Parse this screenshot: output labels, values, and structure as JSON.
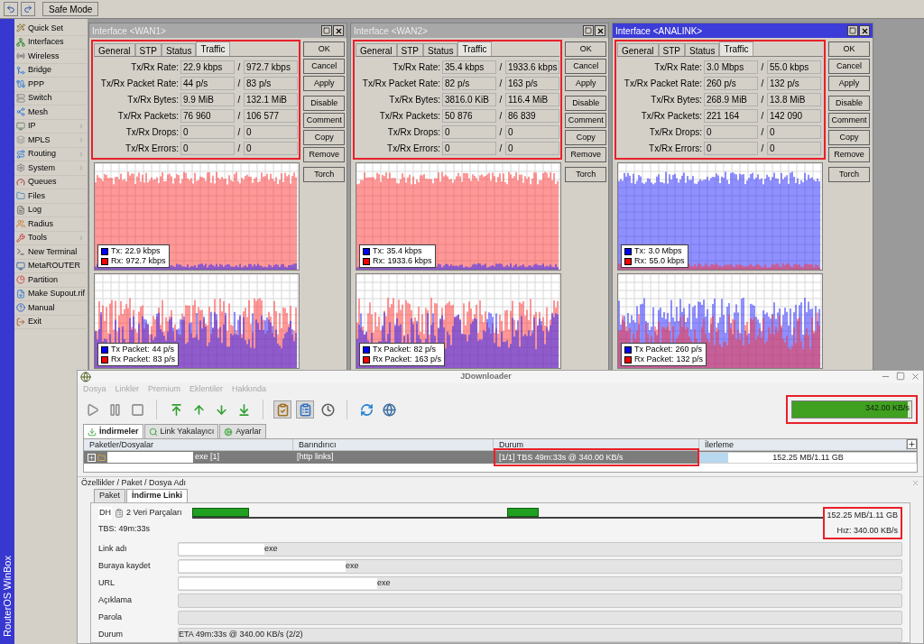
{
  "toolbar": {
    "safe_mode": "Safe Mode"
  },
  "brand": "RouterOS WinBox",
  "menu": [
    {
      "label": "Quick Set",
      "submenu": false
    },
    {
      "label": "Interfaces",
      "submenu": false
    },
    {
      "label": "Wireless",
      "submenu": false
    },
    {
      "label": "Bridge",
      "submenu": false
    },
    {
      "label": "PPP",
      "submenu": false
    },
    {
      "label": "Switch",
      "submenu": false
    },
    {
      "label": "Mesh",
      "submenu": false
    },
    {
      "label": "IP",
      "submenu": true
    },
    {
      "label": "MPLS",
      "submenu": true
    },
    {
      "label": "Routing",
      "submenu": true
    },
    {
      "label": "System",
      "submenu": true
    },
    {
      "label": "Queues",
      "submenu": false
    },
    {
      "label": "Files",
      "submenu": false
    },
    {
      "label": "Log",
      "submenu": false
    },
    {
      "label": "Radius",
      "submenu": false
    },
    {
      "label": "Tools",
      "submenu": true
    },
    {
      "label": "New Terminal",
      "submenu": false
    },
    {
      "label": "MetaROUTER",
      "submenu": false
    },
    {
      "label": "Partition",
      "submenu": false
    },
    {
      "label": "Make Supout.rif",
      "submenu": false
    },
    {
      "label": "Manual",
      "submenu": false
    },
    {
      "label": "Exit",
      "submenu": false
    }
  ],
  "windows": [
    {
      "title": "Interface <WAN1>",
      "active": false,
      "highlighted": true,
      "separator": "/",
      "tabs": [
        {
          "label": "General",
          "selected": false
        },
        {
          "label": "STP",
          "selected": false
        },
        {
          "label": "Status",
          "selected": false
        },
        {
          "label": "Traffic",
          "selected": true
        }
      ],
      "stats": [
        {
          "label": "Tx/Rx Rate:",
          "tx": "22.9 kbps",
          "rx": "972.7 kbps"
        },
        {
          "label": "Tx/Rx Packet Rate:",
          "tx": "44 p/s",
          "rx": "83 p/s"
        },
        {
          "label": "Tx/Rx Bytes:",
          "tx": "9.9 MiB",
          "rx": "132.1 MiB"
        },
        {
          "label": "Tx/Rx Packets:",
          "tx": "76 960",
          "rx": "106 577"
        },
        {
          "label": "Tx/Rx Drops:",
          "tx": "0",
          "rx": "0"
        },
        {
          "label": "Tx/Rx Errors:",
          "tx": "0",
          "rx": "0"
        }
      ],
      "buttons": [
        "OK",
        "Cancel",
        "Apply",
        "Disable",
        "Comment",
        "Copy",
        "Remove",
        "Torch"
      ],
      "traffic_legend": [
        {
          "label": "Tx:",
          "value": "22.9 kbps",
          "color": "#0000ff"
        },
        {
          "label": "Rx:",
          "value": "972.7 kbps",
          "color": "#ff0000"
        }
      ],
      "packet_legend": [
        {
          "label": "Tx Packet:",
          "value": "44 p/s",
          "color": "#0000ff"
        },
        {
          "label": "Rx Packet:",
          "value": "83 p/s",
          "color": "#ff0000"
        }
      ]
    },
    {
      "title": "Interface <WAN2>",
      "active": false,
      "highlighted": true,
      "separator": "/",
      "tabs": [
        {
          "label": "General",
          "selected": false
        },
        {
          "label": "STP",
          "selected": false
        },
        {
          "label": "Status",
          "selected": false
        },
        {
          "label": "Traffic",
          "selected": true
        }
      ],
      "stats": [
        {
          "label": "Tx/Rx Rate:",
          "tx": "35.4 kbps",
          "rx": "1933.6 kbps"
        },
        {
          "label": "Tx/Rx Packet Rate:",
          "tx": "82 p/s",
          "rx": "163 p/s"
        },
        {
          "label": "Tx/Rx Bytes:",
          "tx": "3816.0 KiB",
          "rx": "116.4 MiB"
        },
        {
          "label": "Tx/Rx Packets:",
          "tx": "50 876",
          "rx": "86 839"
        },
        {
          "label": "Tx/Rx Drops:",
          "tx": "0",
          "rx": "0"
        },
        {
          "label": "Tx/Rx Errors:",
          "tx": "0",
          "rx": "0"
        }
      ],
      "buttons": [
        "OK",
        "Cancel",
        "Apply",
        "Disable",
        "Comment",
        "Copy",
        "Remove",
        "Torch"
      ],
      "traffic_legend": [
        {
          "label": "Tx:",
          "value": "35.4 kbps",
          "color": "#0000ff"
        },
        {
          "label": "Rx:",
          "value": "1933.6 kbps",
          "color": "#ff0000"
        }
      ],
      "packet_legend": [
        {
          "label": "Tx Packet:",
          "value": "82 p/s",
          "color": "#0000ff"
        },
        {
          "label": "Rx Packet:",
          "value": "163 p/s",
          "color": "#ff0000"
        }
      ]
    },
    {
      "title": "Interface <ANALINK>",
      "active": true,
      "highlighted": true,
      "separator": "/",
      "tabs": [
        {
          "label": "General",
          "selected": false
        },
        {
          "label": "STP",
          "selected": false
        },
        {
          "label": "Status",
          "selected": false
        },
        {
          "label": "Traffic",
          "selected": true
        }
      ],
      "stats": [
        {
          "label": "Tx/Rx Rate:",
          "tx": "3.0 Mbps",
          "rx": "55.0 kbps"
        },
        {
          "label": "Tx/Rx Packet Rate:",
          "tx": "260 p/s",
          "rx": "132 p/s"
        },
        {
          "label": "Tx/Rx Bytes:",
          "tx": "268.9 MiB",
          "rx": "13.8 MiB"
        },
        {
          "label": "Tx/Rx Packets:",
          "tx": "221 164",
          "rx": "142 090"
        },
        {
          "label": "Tx/Rx Drops:",
          "tx": "0",
          "rx": "0"
        },
        {
          "label": "Tx/Rx Errors:",
          "tx": "0",
          "rx": "0"
        }
      ],
      "buttons": [
        "OK",
        "Cancel",
        "Apply",
        "Disable",
        "Comment",
        "Copy",
        "Remove",
        "Torch"
      ],
      "traffic_legend": [
        {
          "label": "Tx:",
          "value": "3.0 Mbps",
          "color": "#0000ff"
        },
        {
          "label": "Rx:",
          "value": "55.0 kbps",
          "color": "#ff0000"
        }
      ],
      "packet_legend": [
        {
          "label": "Tx Packet:",
          "value": "260 p/s",
          "color": "#0000ff"
        },
        {
          "label": "Rx Packet:",
          "value": "132 p/s",
          "color": "#ff0000"
        }
      ]
    }
  ],
  "downloader": {
    "title": "JDownloader",
    "menu": [
      {
        "label": "Dosya",
        "disabled": true
      },
      {
        "label": "Linkler",
        "disabled": true
      },
      {
        "label": "Premium",
        "disabled": true
      },
      {
        "label": "Eklentiler",
        "disabled": true
      },
      {
        "label": "Hakkında",
        "disabled": true
      }
    ],
    "speed": {
      "text": "342.00 KB/s",
      "level": 0.97,
      "highlighted": true
    },
    "tabs": [
      {
        "label": "İndirmeler",
        "selected": true
      },
      {
        "label": "Link Yakalayıcı",
        "selected": false
      },
      {
        "label": "Ayarlar",
        "selected": false
      }
    ],
    "columns": [
      "Paketler/Dosyalar",
      "Barındırıcı",
      "Durum",
      "İlerleme"
    ],
    "rows": [
      {
        "name": "exe [1]",
        "redacted": true,
        "host": "[http links]",
        "status": "[1/1] TBS 49m:33s @ 340.00 KB/s",
        "status_highlighted": true,
        "progress": "152.25 MB/1.11 GB",
        "level": 0.13,
        "selected": true
      }
    ],
    "details": {
      "title": "Özellikler / Paket / Dosya Adı",
      "tabs": [
        {
          "label": "Paket",
          "selected": false
        },
        {
          "label": "İndirme Linki",
          "selected": true
        }
      ],
      "badge": "DH",
      "chunks_label": "2 Veri Parçaları",
      "chunks": [
        {
          "level": 0.18
        },
        {
          "level": 0.1
        }
      ],
      "size": "152.25 MB/1.11 GB",
      "tbs": "TBS: 49m:33s",
      "speed": "Hız: 340.00 KB/s",
      "highlighted": true,
      "fields": [
        {
          "label": "Link adı",
          "value": "exe",
          "redacted": true
        },
        {
          "label": "Buraya kaydet",
          "value": "exe",
          "redacted": true
        },
        {
          "label": "URL",
          "value": "exe",
          "redacted": true
        },
        {
          "label": "Açıklama",
          "redacted": false
        },
        {
          "label": "Parola",
          "redacted": false
        },
        {
          "label": "Durum",
          "value": "ETA 49m:33s @ 340.00 KB/s (2/2)",
          "redacted": false
        }
      ]
    }
  }
}
